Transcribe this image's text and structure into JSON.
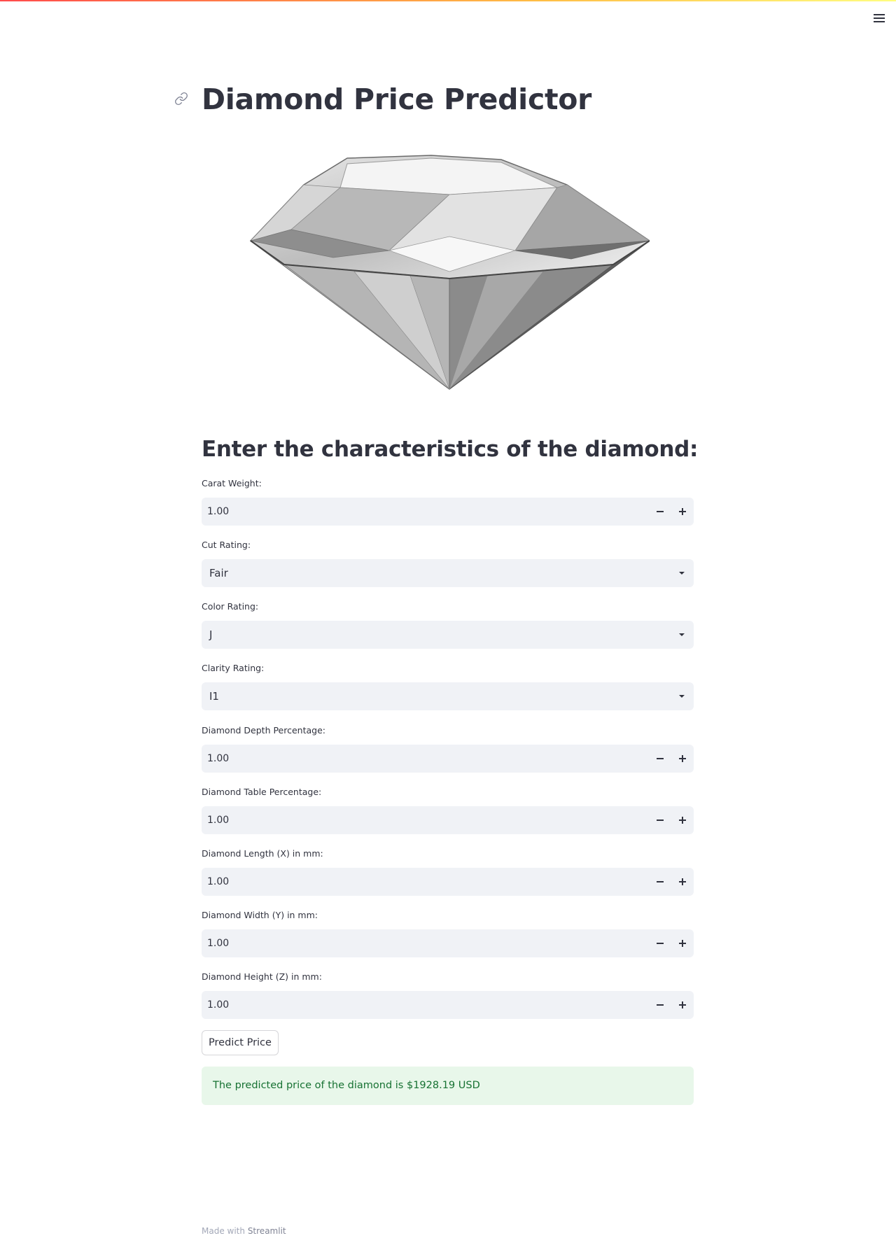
{
  "app": {
    "title": "Diamond Price Predictor",
    "accent_gradient": [
      "#ff4b4b",
      "#ffbd45",
      "#fffd80"
    ],
    "menu_icon": "hamburger-menu-icon",
    "anchor_icon": "link-icon"
  },
  "main": {
    "image_subject": "diamond",
    "form_heading": "Enter the characteristics of the diamond:",
    "fields": {
      "carat": {
        "label": "Carat Weight:",
        "value": "1.00"
      },
      "cut": {
        "label": "Cut Rating:",
        "value": "Fair"
      },
      "color": {
        "label": "Color Rating:",
        "value": "J"
      },
      "clarity": {
        "label": "Clarity Rating:",
        "value": "I1"
      },
      "depth": {
        "label": "Diamond Depth Percentage:",
        "value": "1.00"
      },
      "table": {
        "label": "Diamond Table Percentage:",
        "value": "1.00"
      },
      "x": {
        "label": "Diamond Length (X) in mm:",
        "value": "1.00"
      },
      "y": {
        "label": "Diamond Width (Y) in mm:",
        "value": "1.00"
      },
      "z": {
        "label": "Diamond Height (Z) in mm:",
        "value": "1.00"
      }
    },
    "predict_button": "Predict Price",
    "result": {
      "text": "The predicted price of the diamond is $1928.19 USD",
      "status_color": "#177233",
      "background": "#e8f7ea"
    }
  },
  "footer": {
    "prefix": "Made with",
    "link": "Streamlit"
  }
}
